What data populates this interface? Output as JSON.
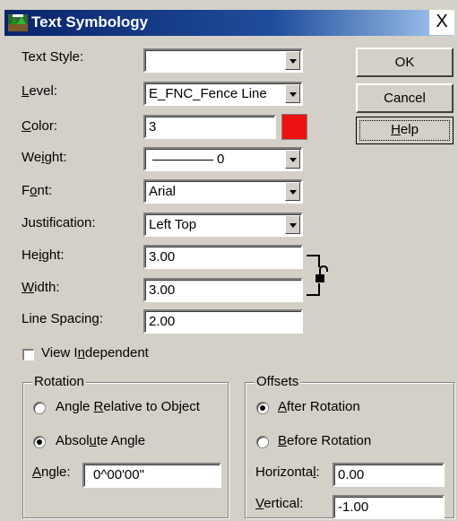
{
  "window": {
    "title": "Text Symbology",
    "close_glyph": "X"
  },
  "labels": {
    "text_style": "Text Style:",
    "level_u": "L",
    "level_rest": "evel:",
    "color_u": "C",
    "color_rest": "olor:",
    "weight_a": "We",
    "weight_u": "i",
    "weight_b": "ght:",
    "font_a": "F",
    "font_u": "o",
    "font_b": "nt:",
    "justification": "Justification:",
    "height_a": "He",
    "height_u": "i",
    "height_b": "ght:",
    "width_u": "W",
    "width_rest": "idth:",
    "line_spacing": "Line Spacing:"
  },
  "fields": {
    "text_style": "",
    "level": "E_FNC_Fence Line",
    "color": "3",
    "weight": "0",
    "font": "Arial",
    "justification": "Left Top",
    "height": "3.00",
    "width": "3.00",
    "line_spacing": "2.00"
  },
  "colors": {
    "color_swatch": "#ee1111",
    "title_bar": "#0a246a"
  },
  "buttons": {
    "ok": "OK",
    "cancel": "Cancel",
    "help_u": "H",
    "help_rest": "elp"
  },
  "view_independent": {
    "a": "View I",
    "u": "n",
    "b": "dependent",
    "checked": false
  },
  "rotation": {
    "title": "Rotation",
    "opt1_a": "Angle ",
    "opt1_u": "R",
    "opt1_b": "elative to Object",
    "opt2_a": "Absol",
    "opt2_u": "u",
    "opt2_b": "te Angle",
    "angle_u": "A",
    "angle_rest": "ngle:",
    "angle_value": "0^00'00\"",
    "selected": "Absolute Angle"
  },
  "offsets": {
    "title": "Offsets",
    "opt1_a": "",
    "opt1_u": "A",
    "opt1_b": "fter Rotation",
    "opt2_a": "",
    "opt2_u": "B",
    "opt2_b": "efore Rotation",
    "horizontal_a": "Horizonta",
    "horizontal_u": "l",
    "horizontal_b": ":",
    "vertical_u": "V",
    "vertical_rest": "ertical:",
    "horizontal_value": "0.00",
    "vertical_value": "-1.00",
    "selected": "After Rotation"
  },
  "icons": [
    "app-icon",
    "close-icon",
    "dropdown-arrow-icon",
    "lock-icon"
  ]
}
